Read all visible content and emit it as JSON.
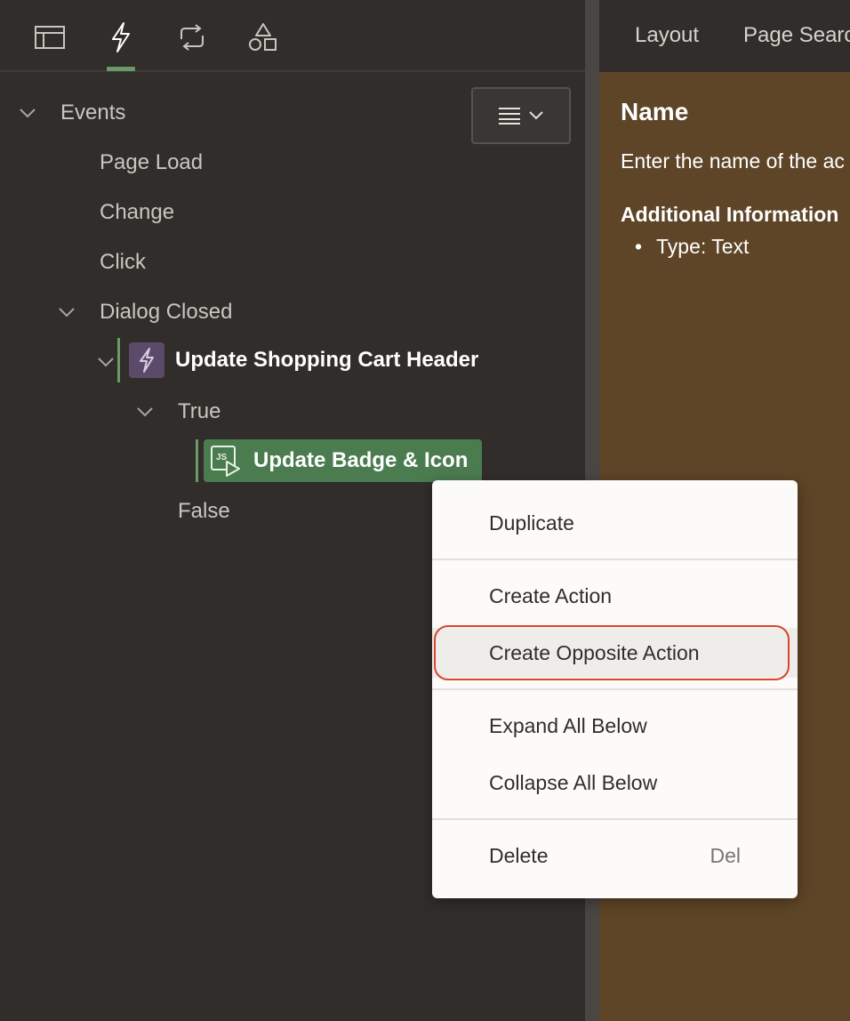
{
  "toolbar": {
    "tabs": [
      {
        "icon": "layout-icon"
      },
      {
        "icon": "lightning-icon",
        "active": true
      },
      {
        "icon": "refresh-icon"
      },
      {
        "icon": "shapes-icon"
      }
    ],
    "accent_color": "#6a9a66"
  },
  "tree": {
    "events_label": "Events",
    "page_load": "Page Load",
    "change": "Change",
    "click": "Click",
    "dialog_closed": "Dialog Closed",
    "dynamic_action": "Update Shopping Cart Header",
    "true_label": "True",
    "action": "Update Badge & Icon",
    "false_label": "False"
  },
  "right": {
    "tabs": [
      "Layout",
      "Page Search"
    ],
    "help_title": "Name",
    "help_desc": "Enter the name of the ac",
    "additional_info": "Additional Information",
    "type_line": "Type: Text"
  },
  "context_menu": {
    "duplicate": "Duplicate",
    "create_action": "Create Action",
    "create_opposite_action": "Create Opposite Action",
    "expand_all_below": "Expand All Below",
    "collapse_all_below": "Collapse All Below",
    "delete": "Delete",
    "delete_shortcut": "Del"
  }
}
